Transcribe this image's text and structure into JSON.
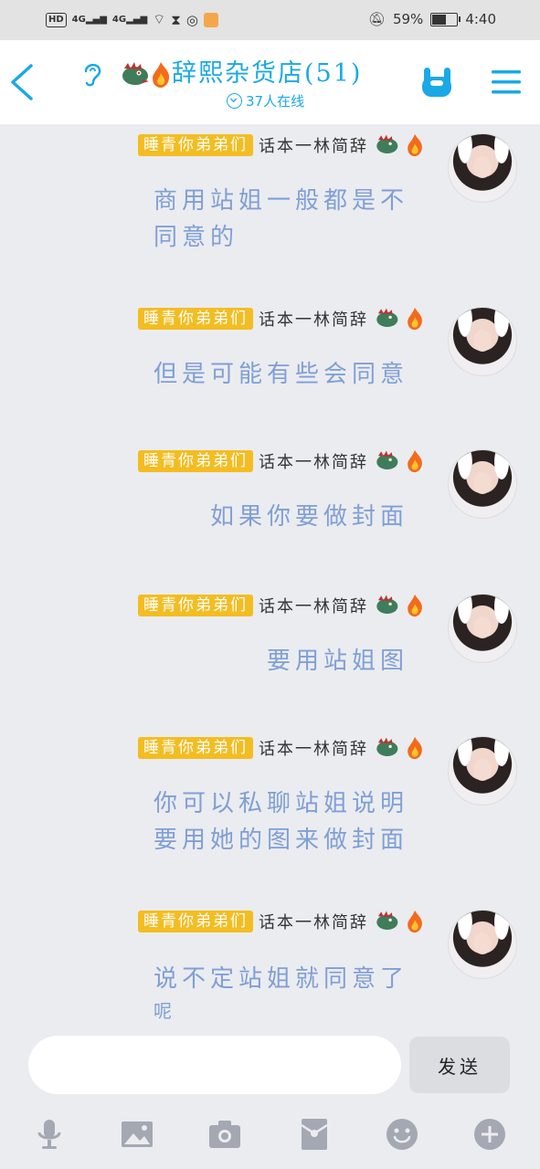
{
  "status_bar": {
    "hd_label": "HD",
    "net1": "4G",
    "net2": "4G",
    "battery_percent": "59%",
    "time": "4:40",
    "battery_level": 0.59
  },
  "header": {
    "title": "辞熙杂货店(51)",
    "online_text": "37人在线"
  },
  "messages": [
    {
      "tag": "睡青你弟弟们",
      "nick": "话本一林简辞",
      "lines": [
        "商用站姐一般都是不",
        "同意的"
      ]
    },
    {
      "tag": "睡青你弟弟们",
      "nick": "话本一林简辞",
      "lines": [
        "但是可能有些会同意"
      ]
    },
    {
      "tag": "睡青你弟弟们",
      "nick": "话本一林简辞",
      "lines": [
        "如果你要做封面"
      ]
    },
    {
      "tag": "睡青你弟弟们",
      "nick": "话本一林简辞",
      "lines": [
        "要用站姐图"
      ]
    },
    {
      "tag": "睡青你弟弟们",
      "nick": "话本一林简辞",
      "lines": [
        "你可以私聊站姐说明",
        "要用她的图来做封面"
      ]
    },
    {
      "tag": "睡青你弟弟们",
      "nick": "话本一林简辞",
      "lines": [
        "说不定站姐就同意了",
        "呢"
      ]
    }
  ],
  "input": {
    "value": "",
    "send_label": "发送"
  },
  "toolbar_icons": [
    "microphone-icon",
    "image-icon",
    "camera-icon",
    "red-packet-icon",
    "emoji-icon",
    "plus-icon"
  ],
  "colors": {
    "accent": "#1aa9e6",
    "tag": "#f3bd22",
    "bubble_text": "#7f9fd6"
  }
}
